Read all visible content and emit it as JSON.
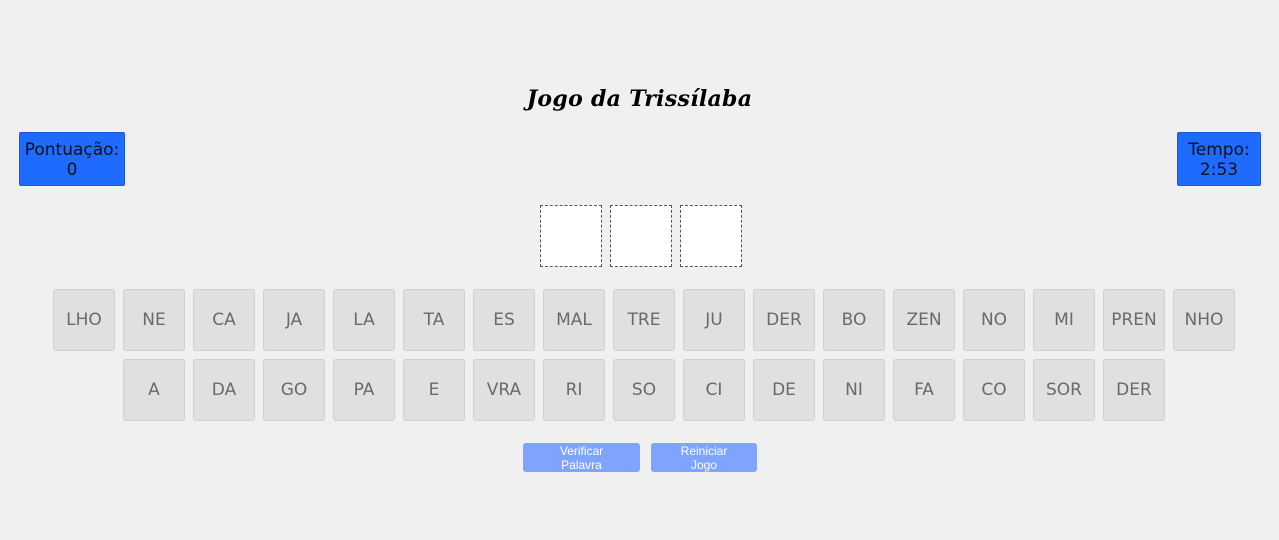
{
  "title": "Jogo da Trissílaba",
  "score": {
    "label": "Pontuação:",
    "value": "0"
  },
  "time": {
    "label": "Tempo:",
    "value": "2:53"
  },
  "slots_count": 3,
  "tiles_row1": [
    "LHO",
    "NE",
    "CA",
    "JA",
    "LA",
    "TA",
    "ES",
    "MAL",
    "TRE",
    "JU",
    "DER",
    "BO",
    "ZEN",
    "NO",
    "MI",
    "PREN",
    "NHO"
  ],
  "tiles_row2": [
    "A",
    "DA",
    "GO",
    "PA",
    "E",
    "VRA",
    "RI",
    "SO",
    "CI",
    "DE",
    "NI",
    "FA",
    "CO",
    "SOR",
    "DER"
  ],
  "buttons": {
    "verify": "Verificar Palavra",
    "restart": "Reiniciar Jogo"
  },
  "colors": {
    "background": "#f0f0f0",
    "info_box": "#1f6bff",
    "tile": "#e0e0e0",
    "tile_text": "#6a6a6a",
    "button": "#7fa4ff"
  }
}
